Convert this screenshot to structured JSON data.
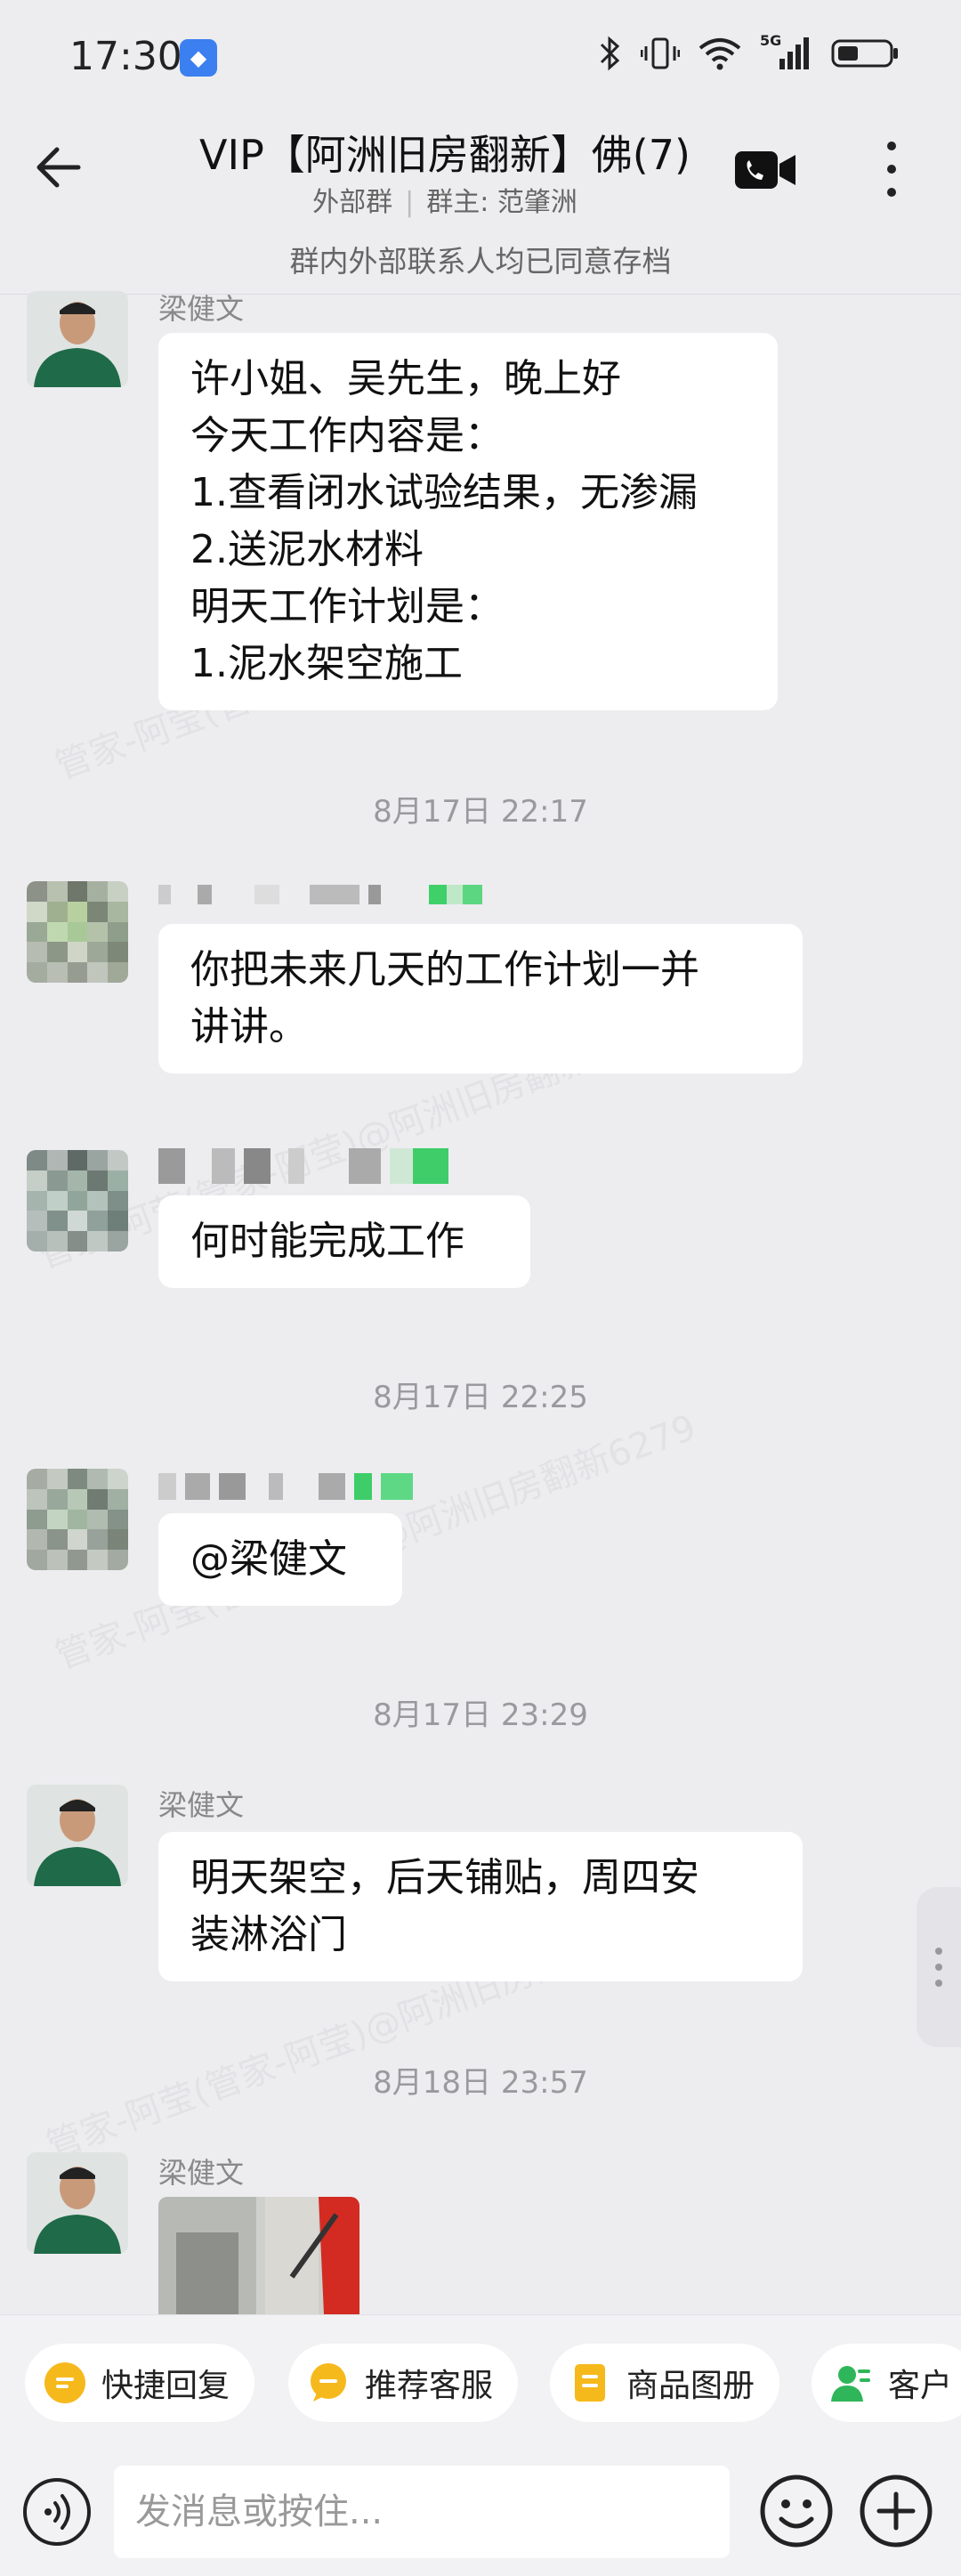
{
  "status": {
    "time": "17:30",
    "network": "5G"
  },
  "header": {
    "title": "VIP【阿洲旧房翻新】佛(7)",
    "sub_left": "外部群",
    "sub_right": "群主: 范肇洲"
  },
  "notice": "群内外部联系人均已同意存档",
  "watermark": "管家-阿莹(管家-阿莹)@阿洲旧房翻新6279",
  "messages": {
    "m1": {
      "sender": "梁健文",
      "text": "许小姐、吴先生，晚上好\n今天工作内容是：\n1.查看闭水试验结果，无渗漏\n2.送泥水材料\n明天工作计划是：\n1.泥水架空施工"
    },
    "t1": "8月17日  22:17",
    "m2": {
      "text": "你把未来几天的工作计划一并\n讲讲。"
    },
    "m3": {
      "text": "何时能完成工作"
    },
    "t2": "8月17日  22:25",
    "m4": {
      "text": "@梁健文"
    },
    "t3": "8月17日  23:29",
    "m5": {
      "sender": "梁健文",
      "text": "明天架空，后天铺贴，周四安\n装淋浴门"
    },
    "t4": "8月18日  23:57",
    "m6": {
      "sender": "梁健文"
    }
  },
  "quick_actions": [
    "快捷回复",
    "推荐客服",
    "商品图册",
    "客户"
  ],
  "input": {
    "placeholder": "发消息或按住..."
  },
  "colors": {
    "accent_yellow": "#f6b91c",
    "green": "#2fb65a",
    "bubble": "#ffffff",
    "bg": "#ededf0"
  }
}
